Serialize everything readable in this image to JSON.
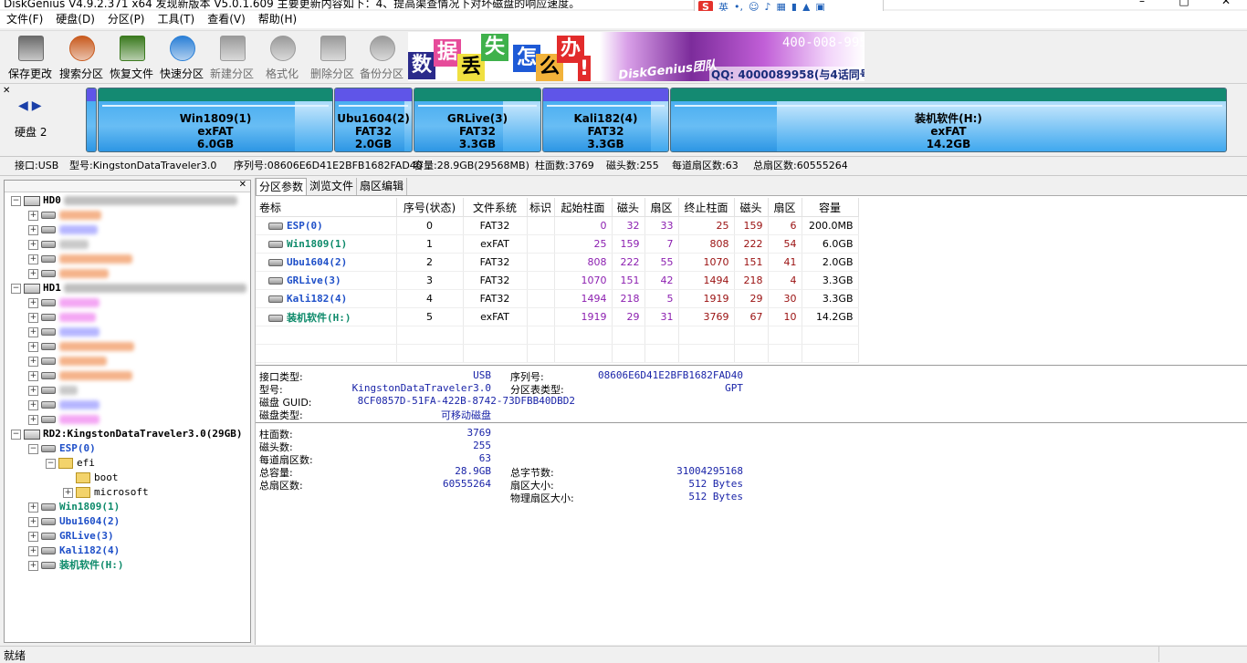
{
  "window": {
    "title": "DiskGenius V4.9.2.371 x64    发现新版本 V5.0.1.609 主要更新内容如下：4、提高渠查情况下对坏磁盘的响应速度。"
  },
  "ime": {
    "brand": "S",
    "lang": "英"
  },
  "menu": [
    "文件(F)",
    "硬盘(D)",
    "分区(P)",
    "工具(T)",
    "查看(V)",
    "帮助(H)"
  ],
  "toolbar": {
    "buttons": [
      {
        "label": "保存更改",
        "color": "#6a6a6a",
        "enabled": true
      },
      {
        "label": "搜索分区",
        "color": "#c85a1e",
        "enabled": true
      },
      {
        "label": "恢复文件",
        "color": "#3b7a1f",
        "enabled": true
      },
      {
        "label": "快速分区",
        "color": "#2a7fd6",
        "enabled": true
      },
      {
        "label": "新建分区",
        "color": "#9a9a9a",
        "enabled": false
      },
      {
        "label": "格式化",
        "color": "#9a9a9a",
        "enabled": false
      },
      {
        "label": "删除分区",
        "color": "#9a9a9a",
        "enabled": false
      },
      {
        "label": "备份分区",
        "color": "#9a9a9a",
        "enabled": false
      }
    ],
    "banner": {
      "chars": [
        "数",
        "据",
        "丢",
        "失",
        "怎",
        "么",
        "办",
        "!"
      ],
      "slogan": "DiskGenius团队",
      "qq": "QQ: 4000089958(与4话同号)",
      "phone": "400-008-9958"
    }
  },
  "diskmap": {
    "disk_label": "硬盘 2",
    "partitions": [
      {
        "name": "Win1809(1)",
        "fs": "exFAT",
        "size": "6.0GB",
        "cap": "green",
        "used": 0.84
      },
      {
        "name": "Ubu1604(2)",
        "fs": "FAT32",
        "size": "2.0GB",
        "cap": "blue",
        "used": 0.9
      },
      {
        "name": "GRLive(3)",
        "fs": "FAT32",
        "size": "3.3GB",
        "cap": "green",
        "used": 0.7
      },
      {
        "name": "Kali182(4)",
        "fs": "FAT32",
        "size": "3.3GB",
        "cap": "blue",
        "used": 0.86
      },
      {
        "name": "装机软件(H:)",
        "fs": "exFAT",
        "size": "14.2GB",
        "cap": "green",
        "used": 0.19
      }
    ]
  },
  "diskinfo": {
    "interface": "接口:USB",
    "model": "型号:KingstonDataTraveler3.0",
    "serial": "序列号:08606E6D41E2BFB1682FAD40",
    "capacity": "容量:28.9GB(29568MB)",
    "cylinders": "柱面数:3769",
    "heads": "磁头数:255",
    "sectors_per_track": "每道扇区数:63",
    "total_sectors": "总扇区数:60555264"
  },
  "tree": {
    "hd0": "HD0",
    "hd1": "HD1",
    "rd2": "RD2:KingstonDataTraveler3.0(29GB)",
    "esp": "ESP(0)",
    "efi": "efi",
    "boot": "boot",
    "microsoft": "microsoft",
    "parts": [
      {
        "label": "Win1809(1)",
        "cls": "green"
      },
      {
        "label": "Ubu1604(2)",
        "cls": "blue"
      },
      {
        "label": "GRLive(3)",
        "cls": "blue"
      },
      {
        "label": "Kali182(4)",
        "cls": "blue"
      },
      {
        "label": "装机软件(H:)",
        "cls": "green"
      }
    ]
  },
  "tabs": [
    "分区参数",
    "浏览文件",
    "扇区编辑"
  ],
  "table": {
    "headers": [
      "卷标",
      "序号(状态)",
      "文件系统",
      "标识",
      "起始柱面",
      "磁头",
      "扇区",
      "终止柱面",
      "磁头",
      "扇区",
      "容量"
    ],
    "rows": [
      {
        "name": "ESP(0)",
        "cls": "blue",
        "idx": "0",
        "fs": "FAT32",
        "flag": "",
        "sc": "0",
        "sh": "32",
        "ss": "33",
        "ec": "25",
        "eh": "159",
        "es": "6",
        "cap": "200.0MB"
      },
      {
        "name": "Win1809(1)",
        "cls": "green",
        "idx": "1",
        "fs": "exFAT",
        "flag": "",
        "sc": "25",
        "sh": "159",
        "ss": "7",
        "ec": "808",
        "eh": "222",
        "es": "54",
        "cap": "6.0GB"
      },
      {
        "name": "Ubu1604(2)",
        "cls": "blue",
        "idx": "2",
        "fs": "FAT32",
        "flag": "",
        "sc": "808",
        "sh": "222",
        "ss": "55",
        "ec": "1070",
        "eh": "151",
        "es": "41",
        "cap": "2.0GB"
      },
      {
        "name": "GRLive(3)",
        "cls": "blue",
        "idx": "3",
        "fs": "FAT32",
        "flag": "",
        "sc": "1070",
        "sh": "151",
        "ss": "42",
        "ec": "1494",
        "eh": "218",
        "es": "4",
        "cap": "3.3GB"
      },
      {
        "name": "Kali182(4)",
        "cls": "blue",
        "idx": "4",
        "fs": "FAT32",
        "flag": "",
        "sc": "1494",
        "sh": "218",
        "ss": "5",
        "ec": "1919",
        "eh": "29",
        "es": "30",
        "cap": "3.3GB"
      },
      {
        "name": "装机软件(H:)",
        "cls": "green",
        "idx": "5",
        "fs": "exFAT",
        "flag": "",
        "sc": "1919",
        "sh": "29",
        "ss": "31",
        "ec": "3769",
        "eh": "67",
        "es": "10",
        "cap": "14.2GB"
      }
    ]
  },
  "info": {
    "interface_type": {
      "k": "接口类型:",
      "v": "USB"
    },
    "model": {
      "k": "型号:",
      "v": "KingstonDataTraveler3.0"
    },
    "disk_guid": {
      "k": "磁盘 GUID:",
      "v": "8CF0857D-51FA-422B-8742-73DFBB40DBD2"
    },
    "disk_type": {
      "k": "磁盘类型:",
      "v": "可移动磁盘"
    },
    "serial": {
      "k": "序列号:",
      "v": "08606E6D41E2BFB1682FAD40"
    },
    "ptable_type": {
      "k": "分区表类型:",
      "v": "GPT"
    },
    "cylinders": {
      "k": "柱面数:",
      "v": "3769"
    },
    "heads": {
      "k": "磁头数:",
      "v": "255"
    },
    "spt": {
      "k": "每道扇区数:",
      "v": "63"
    },
    "capacity": {
      "k": "总容量:",
      "v": "28.9GB"
    },
    "total_sectors": {
      "k": "总扇区数:",
      "v": "60555264"
    },
    "total_bytes": {
      "k": "总字节数:",
      "v": "31004295168"
    },
    "sector_size": {
      "k": "扇区大小:",
      "v": "512 Bytes"
    },
    "phys_sector_size": {
      "k": "物理扇区大小:",
      "v": "512 Bytes"
    }
  },
  "status": "就绪"
}
